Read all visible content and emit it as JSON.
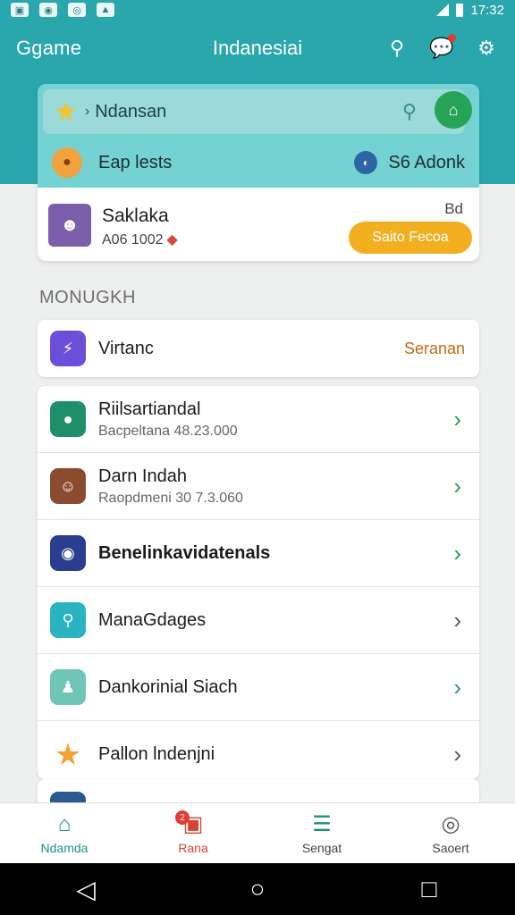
{
  "status_bar": {
    "time": "17:32"
  },
  "app_bar": {
    "brand": "Ggame",
    "title": "Indanesiai"
  },
  "hero": {
    "search_text": "Ndansan",
    "left_label": "Eap lests",
    "right_label": "S6 Adonk",
    "user_name": "Saklaka",
    "user_code": "A06 1002",
    "corner_tag": "Bd",
    "action_button": "Saito Fecoa"
  },
  "section_title": "MONUGKH",
  "featured": {
    "label": "Virtanc",
    "right": "Seranan"
  },
  "list_items": [
    {
      "title": "Riilsartiandal",
      "subtitle": "Bacpeltana 48.23.000"
    },
    {
      "title": "Darn Indah",
      "subtitle": "Raopdmeni 30 7.3.060"
    },
    {
      "title": "Benelinkavidatenals"
    },
    {
      "title": "ManaGdages"
    },
    {
      "title": "Dankorinial Siach"
    },
    {
      "title": "Pallon lndenjni"
    }
  ],
  "bottom_nav": [
    {
      "label": "Ndamda",
      "icon": "home-icon",
      "color": "#1f8f8a"
    },
    {
      "label": "Rana",
      "icon": "ticket-icon",
      "color": "#d64532",
      "badge": "2"
    },
    {
      "label": "Sengat",
      "icon": "list-icon",
      "color": "#1f8f6a"
    },
    {
      "label": "Saoert",
      "icon": "profile-icon",
      "color": "#555555"
    }
  ],
  "colors": {
    "primary": "#2aa7ad",
    "accent_orange": "#f2b021",
    "chevron_green": "#2e9a56"
  }
}
